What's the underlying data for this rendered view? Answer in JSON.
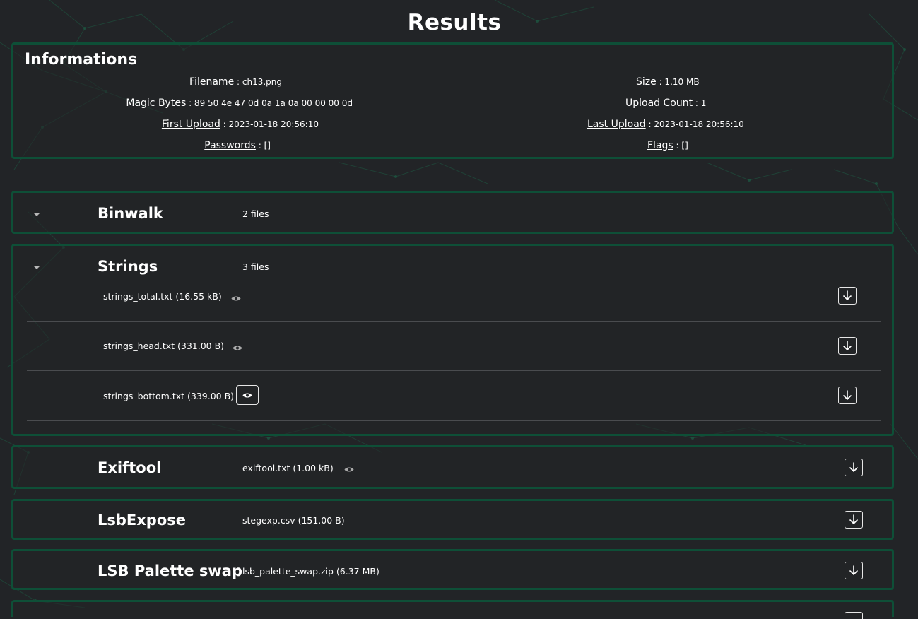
{
  "page": {
    "title": "Results"
  },
  "informations": {
    "title": "Informations",
    "rows": [
      {
        "key": "Filename",
        "value": ": ch13.png"
      },
      {
        "key": "Size",
        "value": ": 1.10 MB"
      },
      {
        "key": "Magic Bytes",
        "value": ": 89 50 4e 47 0d 0a 1a 0a 00 00 00 0d"
      },
      {
        "key": "Upload Count",
        "value": ": 1"
      },
      {
        "key": "First Upload",
        "value": ": 2023-01-18 20:56:10"
      },
      {
        "key": "Last Upload",
        "value": ": 2023-01-18 20:56:10"
      },
      {
        "key": "Passwords",
        "value": ": []"
      },
      {
        "key": "Flags",
        "value": ": []"
      }
    ]
  },
  "sections": {
    "binwalk": {
      "title": "Binwalk",
      "count": "2 files"
    },
    "strings": {
      "title": "Strings",
      "count": "3 files",
      "files": [
        {
          "name": "strings_total.txt (16.55 kB)"
        },
        {
          "name": "strings_head.txt (331.00 B)"
        },
        {
          "name": "strings_bottom.txt (339.00 B)"
        }
      ]
    },
    "exiftool": {
      "title": "Exiftool",
      "file": "exiftool.txt (1.00 kB)"
    },
    "lsbexpose": {
      "title": "LsbExpose",
      "file": "stegexp.csv (151.00 B)"
    },
    "lsbpalette": {
      "title": "LSB Palette swap",
      "file": "lsb_palette_swap.zip (6.37 MB)"
    }
  },
  "icons": {
    "caret": "caret-down-icon",
    "eye": "eye-icon",
    "download": "download-icon"
  },
  "colors": {
    "background": "#222427",
    "panel_border": "#0e4f37",
    "background_lines": "#1d5a43"
  }
}
